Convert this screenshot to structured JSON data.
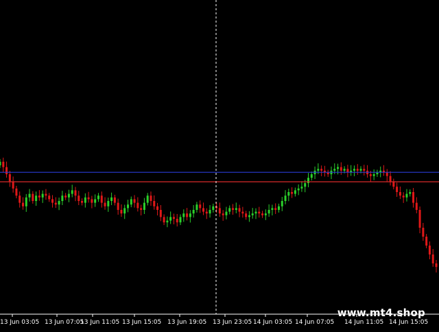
{
  "chart_data": {
    "type": "candlestick",
    "timeframe_ticks": [
      "13 Jun 03:05",
      "13 Jun 07:05",
      "13 Jun 11:05",
      "13 Jun 15:05",
      "13 Jun 19:05",
      "13 Jun 23:05",
      "14 Jun 03:05",
      "14 Jun 07:05",
      "14 Jun 11:05",
      "14 Jun 15:05"
    ],
    "grid": false,
    "crosshair_tick": "13 Jun 23:05",
    "horizontal_levels": [
      {
        "color": "#2a3bd6",
        "relative_level": 0.58
      },
      {
        "color": "#d92a2a",
        "relative_level": 0.55
      }
    ],
    "close_series_relative": [
      0.67,
      0.64,
      0.6,
      0.56,
      0.52,
      0.48,
      0.44,
      0.42,
      0.47,
      0.49,
      0.45,
      0.48,
      0.47,
      0.49,
      0.48,
      0.46,
      0.44,
      0.43,
      0.45,
      0.48,
      0.47,
      0.49,
      0.51,
      0.48,
      0.45,
      0.44,
      0.47,
      0.46,
      0.44,
      0.46,
      0.48,
      0.44,
      0.42,
      0.45,
      0.47,
      0.44,
      0.4,
      0.38,
      0.41,
      0.43,
      0.46,
      0.44,
      0.41,
      0.4,
      0.44,
      0.48,
      0.45,
      0.42,
      0.4,
      0.36,
      0.33,
      0.34,
      0.36,
      0.35,
      0.33,
      0.36,
      0.38,
      0.36,
      0.38,
      0.4,
      0.43,
      0.41,
      0.39,
      0.38,
      0.4,
      0.42,
      0.41,
      0.38,
      0.37,
      0.39,
      0.41,
      0.4,
      0.41,
      0.39,
      0.38,
      0.36,
      0.37,
      0.38,
      0.39,
      0.38,
      0.37,
      0.38,
      0.4,
      0.41,
      0.4,
      0.42,
      0.45,
      0.48,
      0.5,
      0.49,
      0.51,
      0.52,
      0.53,
      0.55,
      0.58,
      0.6,
      0.62,
      0.63,
      0.62,
      0.61,
      0.6,
      0.62,
      0.63,
      0.64,
      0.62,
      0.63,
      0.61,
      0.62,
      0.63,
      0.62,
      0.63,
      0.62,
      0.6,
      0.59,
      0.6,
      0.61,
      0.62,
      0.61,
      0.59,
      0.56,
      0.53,
      0.5,
      0.48,
      0.47,
      0.49,
      0.5,
      0.44,
      0.4,
      0.3,
      0.25,
      0.2,
      0.15,
      0.1,
      0.08
    ]
  },
  "watermark": "www.mt4.shop",
  "colors": {
    "background": "#000000",
    "bull_candle": "#2bd12b",
    "bear_candle": "#e01818",
    "axis": "#ffffff",
    "crosshair": "#ffffff"
  }
}
